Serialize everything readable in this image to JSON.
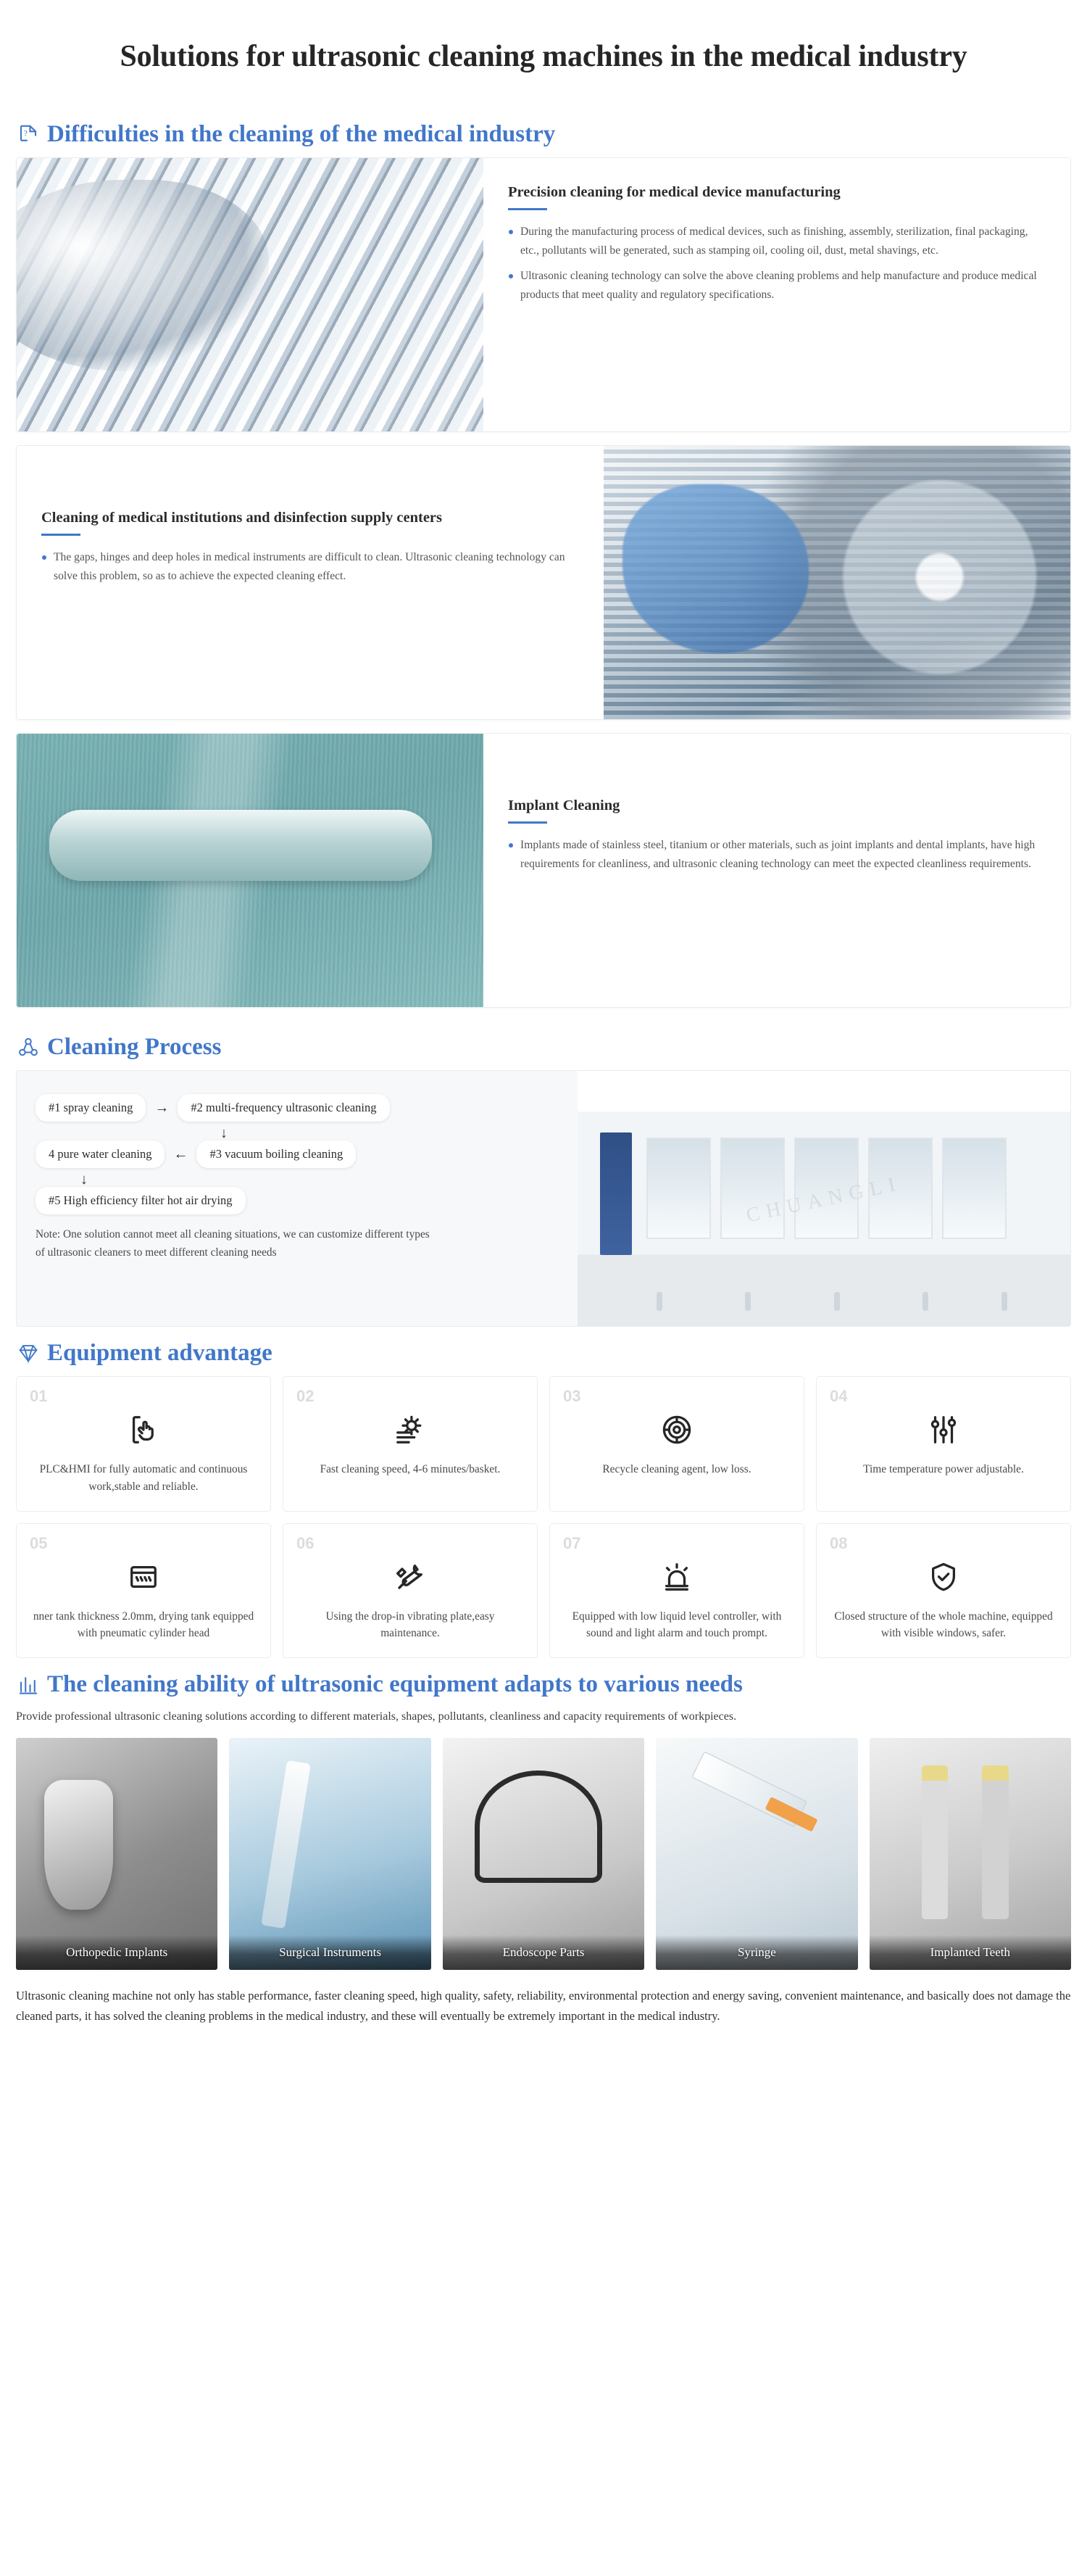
{
  "page": {
    "title": "Solutions for ultrasonic cleaning machines in the medical industry"
  },
  "theme": {
    "accent": "#4177c9",
    "title_color": "#262626",
    "body_text": "#555555",
    "card_border": "#ececec",
    "number_gray": "#dcdcdc"
  },
  "sections": {
    "difficulties": {
      "heading": "Difficulties in the cleaning of the medical industry",
      "icon": "document-question-icon",
      "cards": [
        {
          "title": "Precision cleaning for medical device manufacturing",
          "image_name": "surgical-instruments-photo",
          "bullets": [
            "During the manufacturing process of medical devices, such as finishing, assembly, sterilization, final packaging, etc., pollutants will be generated, such as stamping oil, cooling oil, dust, metal shavings, etc.",
            "Ultrasonic cleaning technology can solve the above cleaning problems and help manufacture and produce medical products that meet quality and regulatory specifications."
          ]
        },
        {
          "title": "Cleaning of medical institutions and disinfection supply centers",
          "image_name": "sterilizer-basket-photo",
          "bullets": [
            "The gaps, hinges and deep holes in medical instruments are difficult to clean. Ultrasonic cleaning technology can solve this problem, so as to achieve the expected cleaning effect."
          ]
        },
        {
          "title": "Implant Cleaning",
          "image_name": "bone-plate-implant-photo",
          "bullets": [
            "Implants made of stainless steel, titanium or other materials, such as joint implants and dental implants, have high requirements for cleanliness, and ultrasonic cleaning technology can meet the expected cleanliness requirements."
          ]
        }
      ]
    },
    "process": {
      "heading": "Cleaning Process",
      "icon": "process-nodes-icon",
      "steps": [
        "#1 spray cleaning",
        "#2 multi-frequency ultrasonic cleaning",
        "#3 vacuum boiling cleaning",
        "4 pure water cleaning",
        "#5 High efficiency filter hot air drying"
      ],
      "arrows": {
        "right": "→",
        "left": "←",
        "down": "↓"
      },
      "note": "Note: One solution cannot meet all cleaning situations, we can customize different types of ultrasonic cleaners to meet different cleaning needs",
      "image_name": "multi-tank-ultrasonic-cleaning-machine-photo",
      "watermark": "CHUANGLI"
    },
    "advantage": {
      "heading": "Equipment advantage",
      "icon": "diamond-icon",
      "items": [
        {
          "number": "01",
          "icon": "touch-hand-icon",
          "text": "PLC&HMI for fully automatic and continuous work,stable and reliable."
        },
        {
          "number": "02",
          "icon": "gear-speed-icon",
          "text": "Fast cleaning speed, 4-6 minutes/basket."
        },
        {
          "number": "03",
          "icon": "recycle-target-icon",
          "text": "Recycle cleaning agent, low loss."
        },
        {
          "number": "04",
          "icon": "sliders-icon",
          "text": "Time temperature power adjustable."
        },
        {
          "number": "05",
          "icon": "drying-tank-icon",
          "text": "nner tank thickness 2.0mm, drying tank equipped with pneumatic cylinder head"
        },
        {
          "number": "06",
          "icon": "tools-wrench-icon",
          "text": "Using the drop-in vibrating plate,easy maintenance."
        },
        {
          "number": "07",
          "icon": "alarm-lamp-icon",
          "text": "Equipped with low liquid level controller, with sound and light alarm and touch prompt."
        },
        {
          "number": "08",
          "icon": "shield-check-icon",
          "text": "Closed structure of the whole machine, equipped with visible windows, safer."
        }
      ]
    },
    "ability": {
      "heading": "The cleaning ability of ultrasonic equipment adapts to various needs",
      "icon": "chart-bars-icon",
      "lead": "Provide professional ultrasonic cleaning solutions according to different materials, shapes, pollutants, cleanliness and capacity requirements of workpieces.",
      "gallery": [
        {
          "caption": "Orthopedic Implants",
          "image_name": "orthopedic-implant-photo"
        },
        {
          "caption": "Surgical Instruments",
          "image_name": "surgical-instruments-photo"
        },
        {
          "caption": "Endoscope Parts",
          "image_name": "endoscope-parts-photo"
        },
        {
          "caption": "Syringe",
          "image_name": "syringe-photo"
        },
        {
          "caption": "Implanted Teeth",
          "image_name": "dental-implant-photo"
        }
      ]
    },
    "outro": "Ultrasonic cleaning machine not only has stable performance, faster cleaning speed, high quality, safety, reliability, environmental protection and energy saving, convenient maintenance, and basically does not damage the cleaned parts, it has solved the cleaning problems in the medical industry, and these will eventually be extremely important in the medical industry."
  }
}
